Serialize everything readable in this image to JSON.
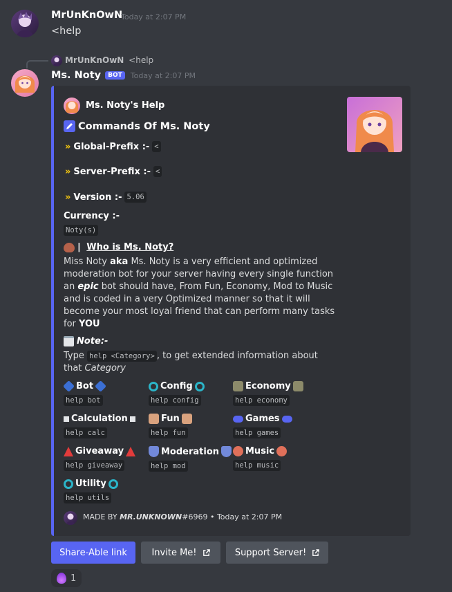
{
  "message1": {
    "username": "MrUnKnOwN",
    "timestamp": "Today at 2:07 PM",
    "text": "<help"
  },
  "reply": {
    "username": "MrUnKnOwN",
    "text": "<help"
  },
  "message2": {
    "username": "Ms. Noty",
    "badge": "BOT",
    "timestamp": "Today at 2:07 PM"
  },
  "embed": {
    "author": "Ms. Noty's Help",
    "title": "Commands Of Ms. Noty",
    "global_prefix_label": "Global-Prefix :-",
    "global_prefix_value": "<",
    "server_prefix_label": "Server-Prefix :-",
    "server_prefix_value": "<",
    "version_label": "Version :-",
    "version_value": "5.06",
    "currency_label": "Currency :-",
    "currency_value": "Noty(s)",
    "who_prefix": "| ",
    "who_link": "Who is Ms. Noty?",
    "desc": {
      "l1": "Miss Noty ",
      "aka": "aka",
      "l1b": " Ms. Noty is a very efficient and optimized",
      "l2": "moderation bot for your server having every single function",
      "l3a": "an ",
      "epic": "epic",
      "l3b": " bot should have, From Fun, Economy, Mod to Music",
      "l4": "and is coded in a very Optimized manner so that it will",
      "l5": "become your most loyal friend that can perform many tasks",
      "l6a": "for ",
      "you": "YOU"
    },
    "note_label": "Note:-",
    "note_type": "Type ",
    "note_code": "help <Category>",
    "note_rest": ", to get extended information about",
    "note_that": "that ",
    "note_category": "Category",
    "categories": [
      {
        "name": "Bot",
        "cmd": "help bot"
      },
      {
        "name": "Config",
        "cmd": "help config"
      },
      {
        "name": "Economy",
        "cmd": "help economy"
      },
      {
        "name": "Calculation",
        "cmd": "help calc"
      },
      {
        "name": "Fun",
        "cmd": "help fun"
      },
      {
        "name": "Games",
        "cmd": "help games"
      },
      {
        "name": "Giveaway",
        "cmd": "help giveaway"
      },
      {
        "name": "Moderation",
        "cmd": "help mod"
      },
      {
        "name": "Music",
        "cmd": "help music"
      },
      {
        "name": "Utility",
        "cmd": "help utils"
      }
    ],
    "footer_made_by": "MADE BY ",
    "footer_author": "𝙈𝙍.𝙐𝙉𝙆𝙉𝙊𝙒𝙉",
    "footer_tag": "#6969",
    "footer_sep": " • ",
    "footer_time": "Today at 2:07 PM"
  },
  "buttons": {
    "share": "Share-Able link",
    "invite": "Invite Me!",
    "support": "Support Server!"
  },
  "reaction": {
    "count": "1"
  },
  "colors": {
    "background": "#36393f",
    "embed_bg": "#2f3136",
    "accent": "#5865f2",
    "chevron": "#f1c40f"
  }
}
